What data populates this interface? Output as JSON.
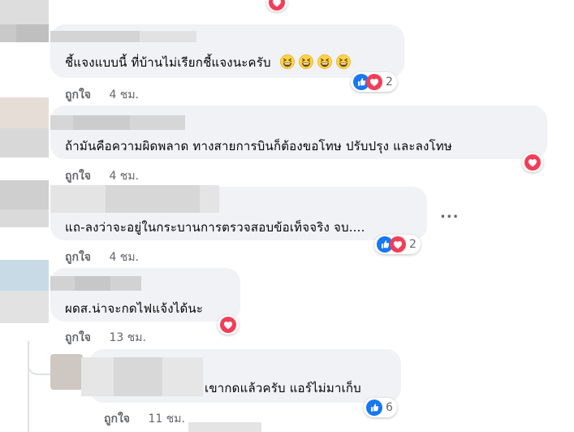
{
  "comments": [
    {
      "text": "ชี้แจงแบบนี้ ที่บ้านไม่เรียกชี้แจงนะครับ",
      "emojis": [
        "grinning-squinting-face",
        "grinning-squinting-face",
        "grinning-squinting-face",
        "grinning-squinting-face"
      ],
      "like_label": "ถูกใจ",
      "time": "4 ชม.",
      "reactions": [
        "like",
        "love"
      ],
      "reaction_count": "2"
    },
    {
      "text": "ถ้ามันคือความผิดพลาด ทางสายการบินก็ต้องขอโทษ ปรับปรุง และลงโทษ",
      "like_label": "ถูกใจ",
      "time": "4 ชม.",
      "reactions": [
        "love"
      ]
    },
    {
      "text": "แถ-ลงว่าจะอยู่ในกระบานการตรวจสอบข้อเท็จจริง จบ....",
      "like_label": "ถูกใจ",
      "time": "4 ชม.",
      "reactions": [
        "like",
        "love"
      ],
      "reaction_count": "2",
      "more_menu": "..."
    },
    {
      "text": "ผดส.น่าจะกดไฟแจ้งได้นะ",
      "like_label": "ถูกใจ",
      "time": "13 ชม.",
      "reactions": [
        "love"
      ]
    },
    {
      "text": "เขากดแล้วครับ แอร์ไม่มาเก็บ",
      "like_label": "ถูกใจ",
      "time": "11 ชม.",
      "reactions": [
        "like"
      ],
      "reaction_count": "6"
    }
  ],
  "colors": {
    "bubble": "#f0f2f5",
    "meta_text": "#65676b",
    "like_blue": "#1877f2",
    "love_red": "#f33e58"
  }
}
